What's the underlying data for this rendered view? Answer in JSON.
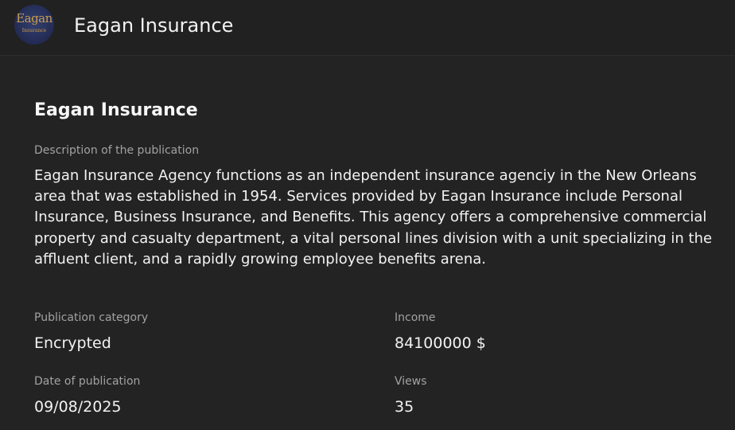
{
  "header": {
    "logo": {
      "text": "Eagan",
      "subtext": "Insurance"
    },
    "title": "Eagan Insurance"
  },
  "publication": {
    "title": "Eagan Insurance",
    "description_label": "Description of the publication",
    "description": "Eagan Insurance Agency functions as an independent insurance agenciy in the New Orleans area that was established in 1954. Services provided by Eagan Insurance include Personal Insurance, Business Insurance, and Benefits. This agency offers a comprehensive commercial property and casualty department, a vital personal lines division with a unit specializing in the affluent client, and a rapidly growing employee benefits arena.",
    "category_label": "Publication category",
    "category": "Encrypted",
    "income_label": "Income",
    "income": "84100000 $",
    "date_label": "Date of publication",
    "date": "09/08/2025",
    "views_label": "Views",
    "views": "35"
  },
  "colors": {
    "background": "#232323",
    "header_background": "#212121",
    "text_primary": "#f2f2f2",
    "text_secondary": "#a2a2a2",
    "logo_navy": "#242c55",
    "logo_gold": "#c99b4c"
  }
}
